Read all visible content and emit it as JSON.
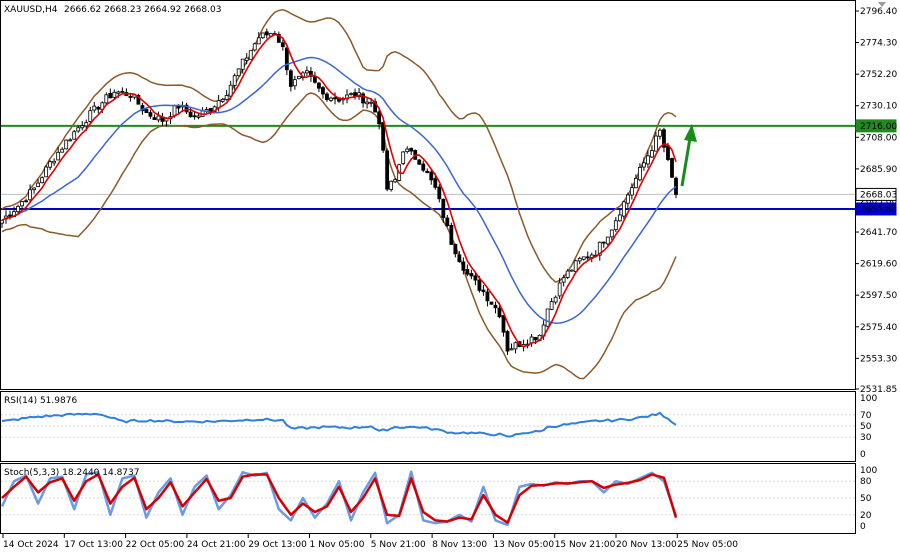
{
  "header": {
    "symbol_tf": "XAUUSD,H4",
    "ohlc": "2666.62 2668.23 2664.92 2668.03"
  },
  "colors": {
    "bollinger": "#8b5a2b",
    "ma_fast": "#e00000",
    "ma_slow": "#3a66d6",
    "resistance_line": "#1f8a1f",
    "support_line": "#0000c8",
    "arrow": "#1a8a1a",
    "rsi": "#2f7fe0",
    "stoch_main": "#6a9ae8",
    "stoch_signal": "#d40000",
    "tag_green": "#1f8a1f",
    "tag_blue": "#0000c8",
    "tag_current": "#ffffff"
  },
  "chart_data": [
    {
      "type": "candlestick",
      "title": "XAUUSD,H4",
      "ylim": [
        2531.85,
        2796.4
      ],
      "y_ticks": [
        "2796.40",
        "2774.30",
        "2752.20",
        "2730.10",
        "2708.00",
        "2685.90",
        "2663.80",
        "2641.70",
        "2619.60",
        "2597.50",
        "2575.40",
        "2553.30",
        "2531.85"
      ],
      "x_ticks": [
        "14 Oct 2024",
        "17 Oct 13:00",
        "22 Oct 05:00",
        "24 Oct 21:00",
        "29 Oct 13:00",
        "1 Nov 05:00",
        "5 Nov 21:00",
        "8 Nov 13:00",
        "13 Nov 05:00",
        "15 Nov 21:00",
        "20 Nov 13:00",
        "25 Nov 05:00"
      ],
      "horizontal_levels": [
        {
          "value": 2716.0,
          "label": "2716.00"
        },
        {
          "value": 2657.85,
          "label": "2657.85"
        }
      ],
      "current_price": {
        "value": 2668.03,
        "label": "2668.03"
      },
      "close_path": [
        [
          0,
          2650
        ],
        [
          4,
          2660
        ],
        [
          8,
          2672
        ],
        [
          12,
          2690
        ],
        [
          16,
          2705
        ],
        [
          20,
          2718
        ],
        [
          24,
          2730
        ],
        [
          28,
          2740
        ],
        [
          32,
          2738
        ],
        [
          36,
          2725
        ],
        [
          40,
          2720
        ],
        [
          44,
          2730
        ],
        [
          48,
          2722
        ],
        [
          52,
          2728
        ],
        [
          56,
          2740
        ],
        [
          60,
          2760
        ],
        [
          64,
          2778
        ],
        [
          68,
          2782
        ],
        [
          70,
          2770
        ],
        [
          72,
          2745
        ],
        [
          76,
          2752
        ],
        [
          80,
          2738
        ],
        [
          84,
          2735
        ],
        [
          88,
          2738
        ],
        [
          92,
          2732
        ],
        [
          94,
          2720
        ],
        [
          96,
          2672
        ],
        [
          98,
          2678
        ],
        [
          100,
          2700
        ],
        [
          104,
          2692
        ],
        [
          108,
          2672
        ],
        [
          112,
          2635
        ],
        [
          116,
          2612
        ],
        [
          120,
          2600
        ],
        [
          124,
          2585
        ],
        [
          126,
          2560
        ],
        [
          130,
          2565
        ],
        [
          134,
          2570
        ],
        [
          136,
          2588
        ],
        [
          140,
          2610
        ],
        [
          144,
          2622
        ],
        [
          148,
          2628
        ],
        [
          152,
          2645
        ],
        [
          156,
          2668
        ],
        [
          160,
          2690
        ],
        [
          164,
          2712
        ],
        [
          166,
          2690
        ],
        [
          168,
          2668
        ]
      ],
      "x_count": 169
    },
    {
      "type": "line",
      "title": "RSI(14) 51.9876",
      "ylim": [
        0,
        100
      ],
      "y_ticks": [
        "100",
        "70",
        "50",
        "30",
        "0"
      ],
      "path": [
        [
          0,
          58
        ],
        [
          8,
          66
        ],
        [
          16,
          70
        ],
        [
          24,
          72
        ],
        [
          30,
          58
        ],
        [
          36,
          60
        ],
        [
          44,
          58
        ],
        [
          52,
          58
        ],
        [
          58,
          60
        ],
        [
          64,
          62
        ],
        [
          70,
          60
        ],
        [
          72,
          45
        ],
        [
          80,
          48
        ],
        [
          88,
          47
        ],
        [
          92,
          50
        ],
        [
          94,
          40
        ],
        [
          98,
          48
        ],
        [
          104,
          48
        ],
        [
          108,
          44
        ],
        [
          112,
          38
        ],
        [
          116,
          38
        ],
        [
          120,
          36
        ],
        [
          124,
          35
        ],
        [
          126,
          30
        ],
        [
          130,
          38
        ],
        [
          134,
          40
        ],
        [
          136,
          48
        ],
        [
          140,
          52
        ],
        [
          144,
          55
        ],
        [
          148,
          59
        ],
        [
          152,
          60
        ],
        [
          156,
          62
        ],
        [
          160,
          66
        ],
        [
          164,
          72
        ],
        [
          166,
          64
        ],
        [
          168,
          51.99
        ]
      ]
    },
    {
      "type": "line",
      "title": "Stoch(5,3,3) 18.2440 14.8737",
      "ylim": [
        0,
        100
      ],
      "y_ticks": [
        "100",
        "80",
        "50",
        "20",
        "0"
      ],
      "main_path": [
        [
          0,
          35
        ],
        [
          3,
          80
        ],
        [
          6,
          90
        ],
        [
          9,
          40
        ],
        [
          12,
          85
        ],
        [
          15,
          88
        ],
        [
          18,
          30
        ],
        [
          21,
          92
        ],
        [
          24,
          96
        ],
        [
          27,
          20
        ],
        [
          30,
          85
        ],
        [
          33,
          90
        ],
        [
          36,
          15
        ],
        [
          39,
          60
        ],
        [
          42,
          85
        ],
        [
          45,
          20
        ],
        [
          48,
          70
        ],
        [
          51,
          90
        ],
        [
          54,
          30
        ],
        [
          57,
          55
        ],
        [
          60,
          96
        ],
        [
          63,
          90
        ],
        [
          66,
          95
        ],
        [
          69,
          30
        ],
        [
          72,
          10
        ],
        [
          75,
          50
        ],
        [
          78,
          15
        ],
        [
          81,
          40
        ],
        [
          84,
          80
        ],
        [
          87,
          10
        ],
        [
          90,
          60
        ],
        [
          93,
          95
        ],
        [
          96,
          5
        ],
        [
          99,
          20
        ],
        [
          102,
          97
        ],
        [
          105,
          10
        ],
        [
          108,
          5
        ],
        [
          111,
          8
        ],
        [
          114,
          20
        ],
        [
          117,
          8
        ],
        [
          120,
          70
        ],
        [
          123,
          10
        ],
        [
          126,
          2
        ],
        [
          129,
          70
        ],
        [
          132,
          75
        ],
        [
          135,
          72
        ],
        [
          138,
          78
        ],
        [
          141,
          75
        ],
        [
          144,
          80
        ],
        [
          147,
          80
        ],
        [
          150,
          60
        ],
        [
          153,
          80
        ],
        [
          156,
          75
        ],
        [
          159,
          85
        ],
        [
          162,
          95
        ],
        [
          165,
          80
        ],
        [
          168,
          18.24
        ]
      ],
      "signal_path": [
        [
          0,
          50
        ],
        [
          3,
          70
        ],
        [
          6,
          88
        ],
        [
          9,
          60
        ],
        [
          12,
          78
        ],
        [
          15,
          85
        ],
        [
          18,
          45
        ],
        [
          21,
          80
        ],
        [
          24,
          92
        ],
        [
          27,
          40
        ],
        [
          30,
          70
        ],
        [
          33,
          86
        ],
        [
          36,
          30
        ],
        [
          39,
          50
        ],
        [
          42,
          78
        ],
        [
          45,
          35
        ],
        [
          48,
          60
        ],
        [
          51,
          84
        ],
        [
          54,
          45
        ],
        [
          57,
          50
        ],
        [
          60,
          88
        ],
        [
          63,
          92
        ],
        [
          66,
          92
        ],
        [
          69,
          50
        ],
        [
          72,
          20
        ],
        [
          75,
          40
        ],
        [
          78,
          25
        ],
        [
          81,
          35
        ],
        [
          84,
          70
        ],
        [
          87,
          25
        ],
        [
          90,
          50
        ],
        [
          93,
          85
        ],
        [
          96,
          20
        ],
        [
          99,
          18
        ],
        [
          102,
          85
        ],
        [
          105,
          25
        ],
        [
          108,
          10
        ],
        [
          111,
          8
        ],
        [
          114,
          15
        ],
        [
          117,
          12
        ],
        [
          120,
          55
        ],
        [
          123,
          20
        ],
        [
          126,
          6
        ],
        [
          129,
          55
        ],
        [
          132,
          72
        ],
        [
          135,
          73
        ],
        [
          138,
          76
        ],
        [
          141,
          76
        ],
        [
          144,
          78
        ],
        [
          147,
          80
        ],
        [
          150,
          68
        ],
        [
          153,
          74
        ],
        [
          156,
          77
        ],
        [
          159,
          82
        ],
        [
          162,
          92
        ],
        [
          165,
          86
        ],
        [
          168,
          14.87
        ]
      ]
    }
  ]
}
